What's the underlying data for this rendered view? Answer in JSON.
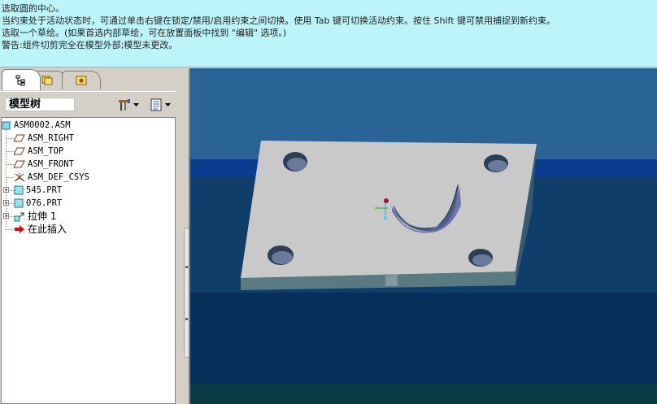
{
  "message_area": {
    "lines": [
      "选取圆的中心。",
      "当约束处于活动状态时，可通过单击右键在锁定/禁用/启用约束之间切换。使用 Tab 键可切换活动约束。按住 Shift 键可禁用捕捉到新约束。",
      "选取一个草绘。(如果首选内部草绘，可在放置面板中找到 \"编辑\" 选项。)",
      "警告:组件切剪完全在模型外部;模型未更改。"
    ]
  },
  "navigator": {
    "tabs": [
      {
        "icon": "model-tree-tab-icon"
      },
      {
        "icon": "folder-browser-tab-icon"
      },
      {
        "icon": "favorites-tab-icon"
      }
    ],
    "title": "模型树",
    "tools": {
      "settings_icon": "tree-settings-icon",
      "columns_icon": "tree-columns-icon"
    }
  },
  "model_tree": {
    "items": [
      {
        "label": "ASM0002.ASM",
        "icon": "assembly-icon"
      },
      {
        "label": "ASM_RIGHT",
        "icon": "datum-plane-icon"
      },
      {
        "label": "ASM_TOP",
        "icon": "datum-plane-icon"
      },
      {
        "label": "ASM_FRONT",
        "icon": "datum-plane-icon"
      },
      {
        "label": "ASM_DEF_CSYS",
        "icon": "csys-icon"
      },
      {
        "label": "545.PRT",
        "icon": "part-icon"
      },
      {
        "label": "076.PRT",
        "icon": "part-icon"
      },
      {
        "label": "拉伸 1",
        "icon": "extrude-icon"
      },
      {
        "label": "在此插入",
        "icon": "insert-here-arrow-icon"
      }
    ]
  },
  "viewport": {
    "background_colors": [
      "#2a6396",
      "#0b3d8f",
      "#0f3e6b",
      "#06305a",
      "#0b3b46"
    ],
    "model_color": "#c9c9c9"
  }
}
